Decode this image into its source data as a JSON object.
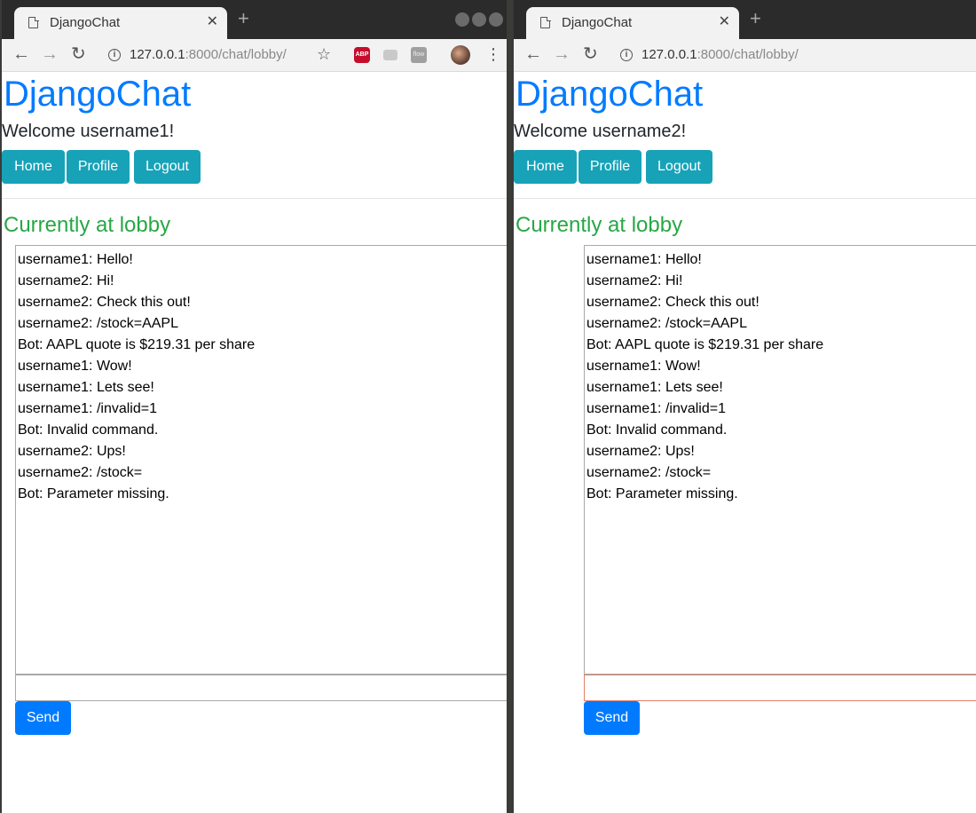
{
  "browsers": [
    {
      "tab_title": "DjangoChat",
      "url_host": "127.0.0.1",
      "url_rest": ":8000/chat/lobby/",
      "brand": "DjangoChat",
      "welcome": "Welcome username1!",
      "nav": {
        "home": "Home",
        "profile": "Profile",
        "logout": "Logout"
      },
      "room_heading": "Currently at lobby",
      "send_label": "Send",
      "message_input_value": "",
      "messages": [
        "username1: Hello!",
        "username2: Hi!",
        "username2: Check this out!",
        "username2: /stock=AAPL",
        "Bot: AAPL quote is $219.31 per share",
        "username1: Wow!",
        "username1: Lets see!",
        "username1: /invalid=1",
        "Bot: Invalid command.",
        "username2: Ups!",
        "username2: /stock=",
        "Bot: Parameter missing."
      ]
    },
    {
      "tab_title": "DjangoChat",
      "url_host": "127.0.0.1",
      "url_rest": ":8000/chat/lobby/",
      "brand": "DjangoChat",
      "welcome": "Welcome username2!",
      "nav": {
        "home": "Home",
        "profile": "Profile",
        "logout": "Logout"
      },
      "room_heading": "Currently at lobby",
      "send_label": "Send",
      "message_input_value": "",
      "messages": [
        "username1: Hello!",
        "username2: Hi!",
        "username2: Check this out!",
        "username2: /stock=AAPL",
        "Bot: AAPL quote is $219.31 per share",
        "username1: Wow!",
        "username1: Lets see!",
        "username1: /invalid=1",
        "Bot: Invalid command.",
        "username2: Ups!",
        "username2: /stock=",
        "Bot: Parameter missing."
      ]
    }
  ],
  "extensions": {
    "abp_label": "ABP",
    "flow_label": "flow"
  },
  "colors": {
    "brand": "#007bff",
    "nav_button": "#17a2b8",
    "lobby_heading": "#28a745",
    "send_button": "#007bff"
  }
}
